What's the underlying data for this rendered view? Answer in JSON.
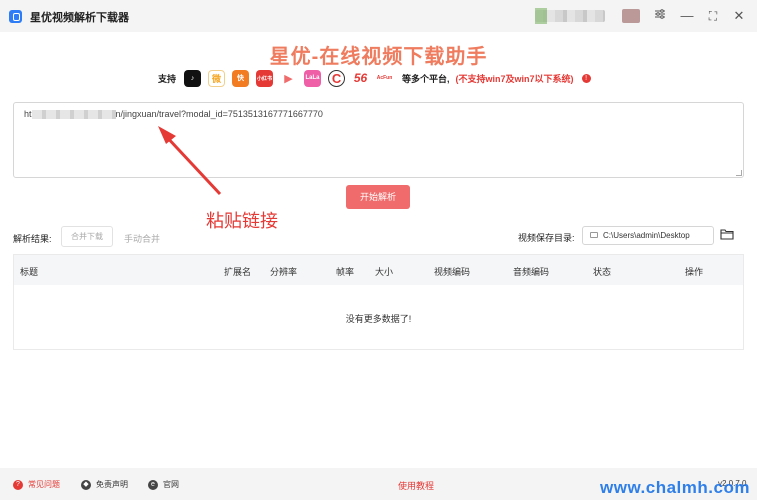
{
  "app": {
    "title": "星优视频解析下载器"
  },
  "window": {
    "settings_icon": "sliders-icon",
    "min": "—",
    "max": "⛶",
    "close": "✕"
  },
  "headline": "星优-在线视频下载助手",
  "platforms": {
    "support_label": "支持",
    "icons": [
      {
        "name": "douyin-icon",
        "text": "♪",
        "color": "#111111"
      },
      {
        "name": "weibo-icon",
        "text": "微",
        "color": "#f5a623"
      },
      {
        "name": "kuaishou-icon",
        "text": "快",
        "color": "#f27c22"
      },
      {
        "name": "xiaohongshu-icon",
        "text": "小红书",
        "color": "#e53935"
      },
      {
        "name": "play-icon",
        "text": "▶",
        "color": "#ffffff"
      },
      {
        "name": "lala-icon",
        "text": "LaLa",
        "color": "#ef5fa7"
      },
      {
        "name": "c-icon",
        "text": "C",
        "color": "#e53935"
      },
      {
        "name": "56-icon",
        "text": "56",
        "color": "#ffffff"
      },
      {
        "name": "acfun-icon",
        "text": "AcFun",
        "color": "#ffffff"
      }
    ],
    "more_label": "等多个平台,",
    "warning": "(不支持win7及win7以下系统)"
  },
  "url_input": {
    "prefix": "ht",
    "suffix": "n/jingxuan/travel?modal_id=7513513167771667770"
  },
  "parse_button": "开始解析",
  "annotation": "粘贴链接",
  "results": {
    "label": "解析结果:",
    "merge_button": "合并下载",
    "manual_merge": "手动合并",
    "save_dir_label": "视频保存目录:",
    "save_dir_value": "C:\\Users\\admin\\Desktop"
  },
  "table": {
    "columns": [
      "标题",
      "扩展名",
      "分辨率",
      "帧率",
      "大小",
      "视频编码",
      "音频编码",
      "状态",
      "操作"
    ],
    "empty": "没有更多数据了!"
  },
  "footer": {
    "faq": "常见问题",
    "disclaimer": "免责声明",
    "website": "官网",
    "tutorial": "使用教程",
    "version": "v2.0.7.0"
  },
  "watermark": "www.chalmh.com",
  "colors": {
    "accent": "#f06b6b",
    "headline": "#ef7c5e",
    "warning": "#e53935",
    "logo": "#2e7cf6"
  }
}
